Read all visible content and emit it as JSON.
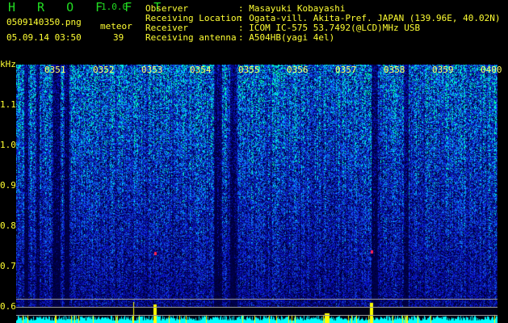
{
  "app": {
    "name": "H R O F F T",
    "version": "1.0.0"
  },
  "file": {
    "name": "0509140350.png",
    "datetime": "05.09.14 03:50"
  },
  "meteor": {
    "label": "meteor",
    "count": "39"
  },
  "info": [
    {
      "label": "Observer",
      "value": ": Masayuki Kobayashi"
    },
    {
      "label": "Receiving Location",
      "value": ": Ogata-vill. Akita-Pref. JAPAN (139.96E, 40.02N)"
    },
    {
      "label": "Receiver",
      "value": ": ICOM IC-575 53.7492(@LCD)MHz USB"
    },
    {
      "label": "Receiving antenna",
      "value": ": A504HB(yagi 4el)"
    }
  ],
  "axis": {
    "y_unit": "kHz",
    "y_ticks": [
      "1.1",
      "1.0",
      "0.9",
      "0.8",
      "0.7",
      "0.6"
    ],
    "time_ticks": [
      "0351",
      "0352",
      "0353",
      "0354",
      "0355",
      "0356",
      "0357",
      "0358",
      "0359",
      "0400"
    ]
  },
  "colors": {
    "text": "#ffff33",
    "title": "#22dd22",
    "histogram": "#00ffff",
    "spikes": "#ffff00"
  }
}
